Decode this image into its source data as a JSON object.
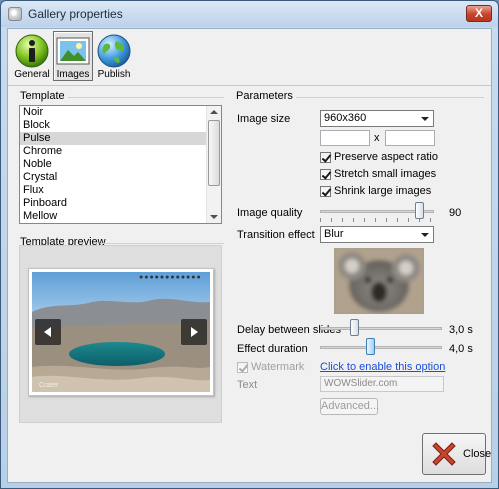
{
  "window": {
    "title": "Gallery properties",
    "close_glyph": "X"
  },
  "toolbar": {
    "buttons": [
      {
        "label": "General",
        "icon": "info-icon"
      },
      {
        "label": "Images",
        "icon": "image-icon",
        "active": true
      },
      {
        "label": "Publish",
        "icon": "globe-icon"
      }
    ]
  },
  "template": {
    "group_label": "Template",
    "items": [
      "Noir",
      "Block",
      "Pulse",
      "Chrome",
      "Noble",
      "Crystal",
      "Flux",
      "Pinboard",
      "Mellow"
    ],
    "selected": "Pulse",
    "preview_label": "Template preview",
    "preview_caption": "Crater",
    "preview_dots": "●●●●●●●●●●●●"
  },
  "parameters": {
    "group_label": "Parameters",
    "image_size": {
      "label": "Image size",
      "value": "960x360",
      "width": "",
      "height": "",
      "x_sep": "x"
    },
    "checkboxes": [
      {
        "label": "Preserve aspect ratio",
        "checked": true
      },
      {
        "label": "Stretch small images",
        "checked": true
      },
      {
        "label": "Shrink large images",
        "checked": true
      }
    ],
    "image_quality": {
      "label": "Image quality",
      "value": "90",
      "level": 0.9
    },
    "transition_effect": {
      "label": "Transition effect",
      "value": "Blur"
    },
    "delay_between_slides": {
      "label": "Delay between slides",
      "value": "3,0 s"
    },
    "effect_duration": {
      "label": "Effect duration",
      "value": "4,0 s"
    },
    "watermark": {
      "label": "Watermark",
      "checked": true,
      "enabled": false,
      "link": "Click to enable this option"
    },
    "text": {
      "label": "Text",
      "value": "WOWSlider.com"
    },
    "advanced_button": "Advanced..."
  },
  "footer": {
    "close_label": "Close"
  },
  "colors": {
    "accent": "#1a4fd6",
    "close_red": "#c7452e"
  }
}
